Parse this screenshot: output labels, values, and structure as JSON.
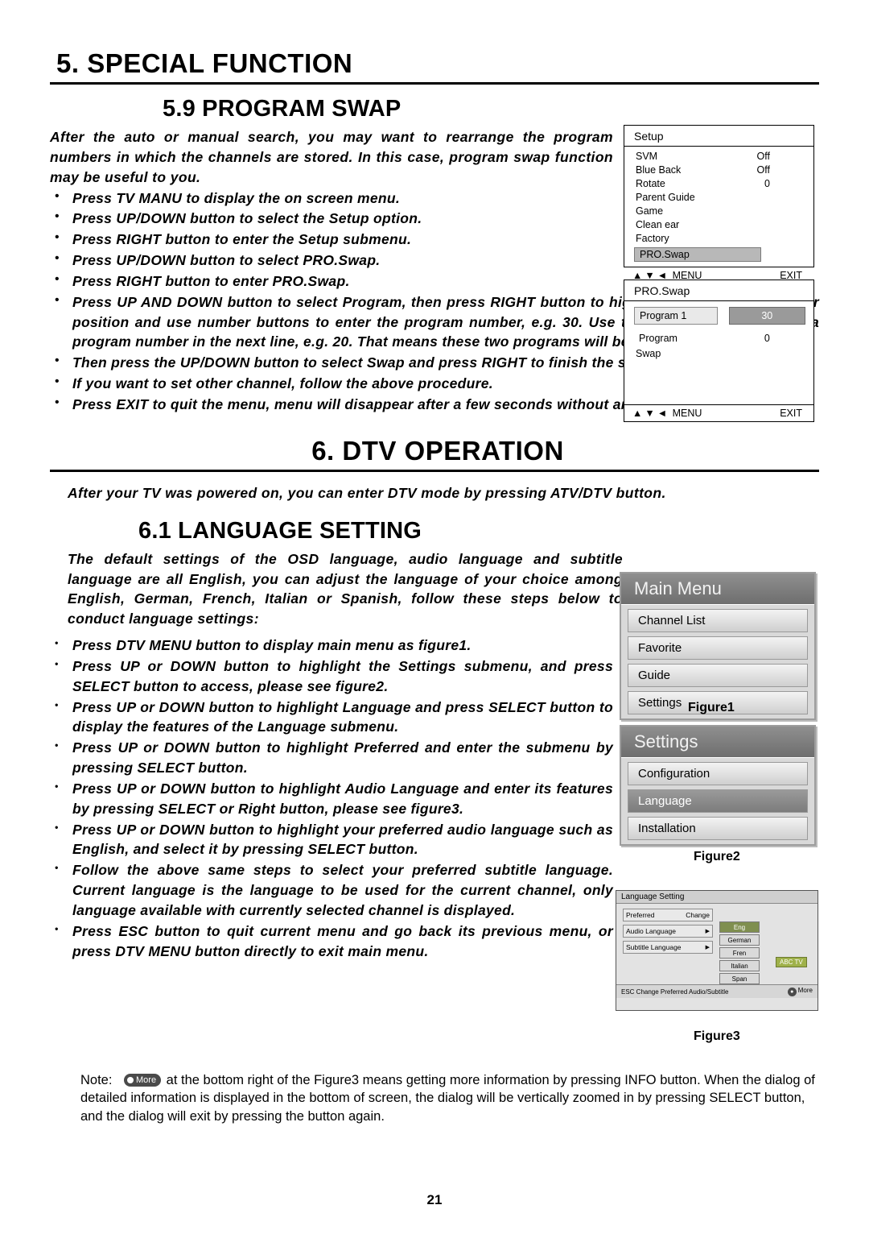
{
  "section5": {
    "heading": "5.  SPECIAL FUNCTION",
    "subheading": "5.9 PROGRAM SWAP",
    "intro": "After the auto or manual search, you may want to rearrange the program numbers in which the channels are stored. In this case, program swap function may be useful to you.",
    "bullets": [
      "Press TV MANU to display the on screen menu.",
      "Press UP/DOWN button to select the Setup option.",
      "Press RIGHT button to enter the Setup submenu.",
      "Press UP/DOWN button to select PRO.Swap.",
      "Press RIGHT button to enter PRO.Swap.",
      "Press UP AND DOWN button to select Program, then press RIGHT button to highlight the program number position and use number buttons to enter the program number, e.g. 30. Use the same method to enter a program number in the next line, e.g. 20. That means these two programs will be switched.",
      "Then press the UP/DOWN button to select Swap and press RIGHT to finish the setting.",
      "If you want to set other channel, follow the above procedure.",
      "Press EXIT to quit the menu, menu will disappear after a few seconds without any further action."
    ],
    "osd_setup": {
      "title": "Setup",
      "rows": [
        {
          "label": "SVM",
          "value": "Off"
        },
        {
          "label": "Blue Back",
          "value": "Off"
        },
        {
          "label": "Rotate",
          "value": "0"
        },
        {
          "label": "Parent Guide",
          "value": ""
        },
        {
          "label": "Game",
          "value": ""
        },
        {
          "label": "Clean ear",
          "value": ""
        },
        {
          "label": "Factory",
          "value": ""
        }
      ],
      "selected": "PRO.Swap",
      "foot_left": "MENU",
      "foot_right": "EXIT"
    },
    "osd_swap": {
      "title": "PRO.Swap",
      "row1_label": "Program 1",
      "row1_value": "30",
      "row2_label": "Program",
      "row2_sub": "Swap",
      "row2_value": "0",
      "foot_left": "MENU",
      "foot_right": "EXIT"
    }
  },
  "section6": {
    "heading": "6.  DTV OPERATION",
    "intro": "After your TV was powered on, you can enter DTV mode by pressing ATV/DTV button.",
    "subheading": "6.1 LANGUAGE SETTING",
    "intro2": "The default settings of the OSD language, audio language and subtitle language are all English, you can adjust the language of your choice among English, German, French, Italian or Spanish, follow these steps below to conduct language settings:",
    "bullets": [
      "Press DTV MENU button to display main menu as figure1.",
      "Press UP or DOWN button to highlight the Settings submenu, and press SELECT button to access, please see figure2.",
      "Press UP or DOWN button to highlight Language and press SELECT button to display the features of the Language submenu.",
      "Press UP or DOWN button to highlight Preferred and enter the submenu by pressing SELECT button.",
      "Press UP or DOWN button to highlight Audio Language and enter its features by pressing SELECT or Right button, please see figure3.",
      "Press UP or DOWN button to highlight your preferred audio language such as English, and select it by pressing SELECT button.",
      "Follow the above same steps to select your preferred subtitle language. Current language is the language to be used for the current channel, only language available with currently selected channel is displayed.",
      "Press ESC button to quit current menu and go back its previous menu, or press DTV MENU button directly to exit main menu."
    ],
    "figure1": {
      "title": "Main Menu",
      "items": [
        "Channel List",
        "Favorite",
        "Guide",
        "Settings"
      ],
      "caption": "Figure1"
    },
    "figure2": {
      "title": "Settings",
      "items": [
        "Configuration",
        "Language",
        "Installation"
      ],
      "selected_index": 1,
      "caption": "Figure2"
    },
    "figure3": {
      "title": "Language Setting",
      "rows": [
        {
          "label": "Preferred",
          "value": "Change"
        },
        {
          "label": "Audio Language",
          "value": ""
        },
        {
          "label": "Subtitle Language",
          "value": ""
        }
      ],
      "options": [
        "Eng",
        "German",
        "Fren",
        "Italian",
        "Span"
      ],
      "selected_option": "Eng",
      "badge": "ABC TV",
      "foot_left": "ESC    Change Preferred Audio/Subtitle",
      "foot_right": "More",
      "caption": "Figure3"
    }
  },
  "note": {
    "label": "Note:",
    "more_label": "More",
    "text_part1": "at the bottom right of the Figure3 means getting more information by pressing INFO button. When the dialog of detailed information is displayed in the bottom of screen, the dialog will be vertically zoomed in by pressing SELECT button, and the dialog will exit by pressing the button again."
  },
  "page_number": "21"
}
